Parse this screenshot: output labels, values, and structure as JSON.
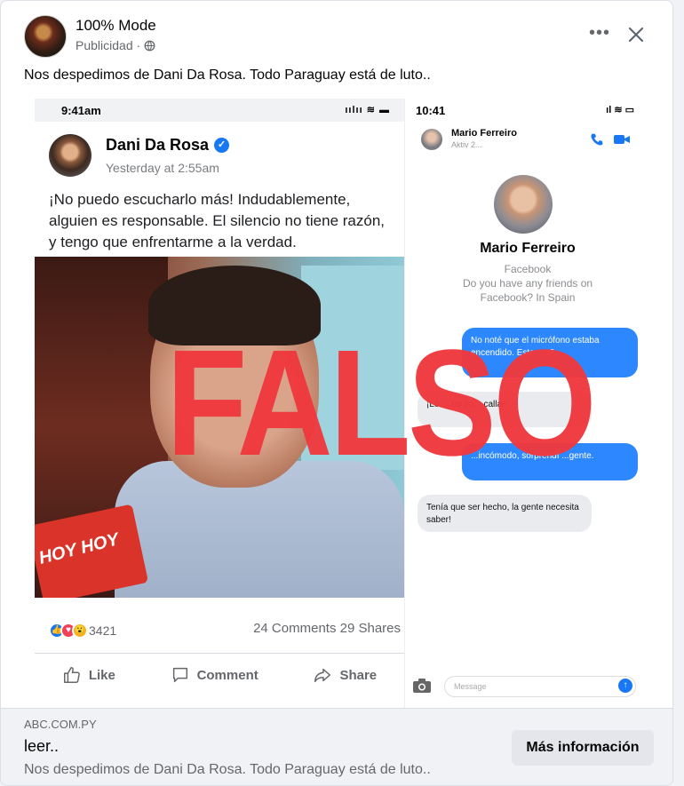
{
  "post": {
    "page_name": "100% Mode",
    "sponsored": "Publicidad ·",
    "caption": "Nos despedimos de Dani Da Rosa. Todo Paraguay está de luto..",
    "more_icon": "•••",
    "close_icon": "close-icon"
  },
  "creative": {
    "left_phone": {
      "status_time": "9:41am",
      "status_icons": "ıılıı ≋ ▬",
      "author": "Dani Da Rosa",
      "timestamp": "Yesterday at 2:55am",
      "text": "¡No puedo escucharlo más! Indudablemente, alguien es responsable. El silencio no tiene razón, y tengo que enfrentarme a la verdad.",
      "mic_flag": "HOY HOY",
      "reaction_count": "3421",
      "comments_shares": "24 Comments  29 Shares",
      "actions": [
        "Like",
        "Comment",
        "Share"
      ]
    },
    "right_phone": {
      "status_time": "10:41",
      "status_icons": "ıl ≋ ▭",
      "chat_name": "Mario Ferreiro",
      "chat_sub": "Aktiv 2...",
      "contact_name": "Mario Ferreiro",
      "contact_line1": "Facebook",
      "contact_line2": "Do you have any friends on",
      "contact_line3": "Facebook? In Spain",
      "bubbles": [
        "No noté que el micrófono estaba encendido. Este ...o?",
        "¡Lo ... no pu... callar!",
        "...incómodo, sorprendí ...gente.",
        "Tenía que ser hecho, la gente necesita saber!"
      ],
      "message_placeholder": "Message"
    },
    "stamp": "FALSO"
  },
  "footer": {
    "domain": "ABC.COM.PY",
    "title": "leer..",
    "description": "Nos despedimos de Dani Da Rosa. Todo Paraguay está de luto..",
    "cta": "Más información"
  },
  "colors": {
    "stamp": "#f0383d",
    "brand_blue": "#1877f2"
  }
}
